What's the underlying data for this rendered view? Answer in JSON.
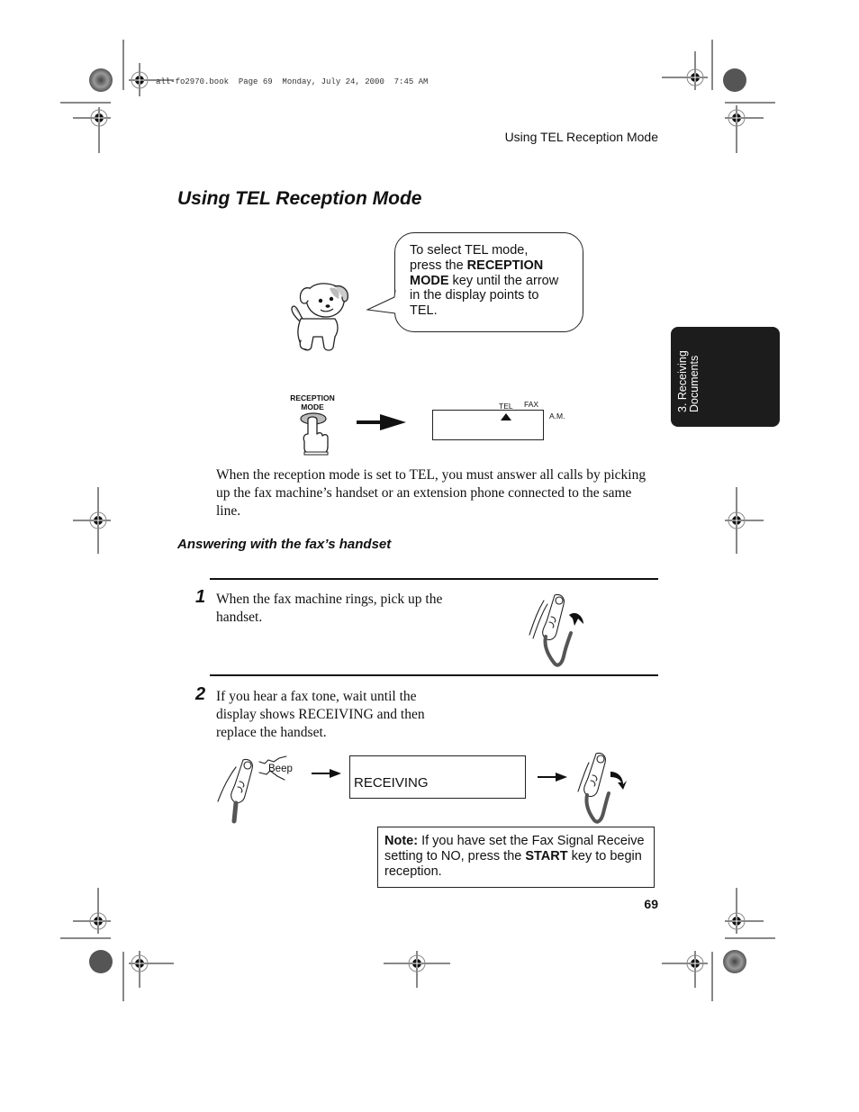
{
  "print_header": {
    "text": "all-fo2970.book  Page 69  Monday, July 24, 2000  7:45 AM"
  },
  "running_head": "Using TEL Reception Mode",
  "page_title": "Using TEL Reception Mode",
  "callout": {
    "line1": "To select TEL mode,",
    "line2_pre": "press the ",
    "line2_bold": "RECEPTION",
    "line3_bold": "MODE",
    "line3_post": " key until the arrow",
    "line4": "in the display points to",
    "line5": "TEL."
  },
  "side_tab": {
    "line1": "3. Receiving",
    "line2": "Documents",
    "background": "#1c1c1c"
  },
  "reception_mode_key": {
    "label_line1": "RECEPTION",
    "label_line2": "MODE"
  },
  "display_panel": {
    "tel_label": "TEL",
    "fax_label": "FAX",
    "am_label": "A.M.",
    "arrow_points_to": "TEL"
  },
  "intro_paragraph": "When the reception mode is set to TEL, you must answer all calls by picking up the fax machine’s handset or an extension phone connected to the same line.",
  "subheading": "Answering with the fax’s handset",
  "steps": [
    {
      "number": "1",
      "text": "When the fax machine rings, pick up the handset."
    },
    {
      "number": "2",
      "text": "If you hear a fax tone, wait until the display shows RECEIVING and then replace the handset."
    }
  ],
  "step2_illustration": {
    "beep_label": "Beep",
    "display_text": "RECEIVING"
  },
  "note": {
    "label": "Note:",
    "text_pre": " If you have set the Fax Signal Receive setting to NO, press the ",
    "bold": "START",
    "text_post": " key to begin reception."
  },
  "page_number": "69"
}
